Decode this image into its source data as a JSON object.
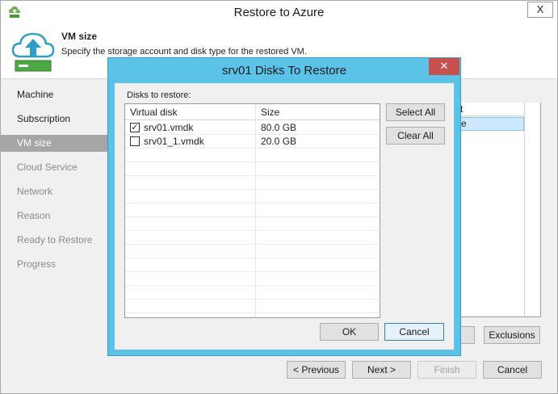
{
  "window": {
    "title": "Restore to Azure",
    "close_glyph": "X"
  },
  "header": {
    "title": "VM size",
    "description": "Specify the storage account and disk type for the restored VM."
  },
  "sidebar": {
    "items": [
      {
        "label": "Machine",
        "state": "normal"
      },
      {
        "label": "Subscription",
        "state": "normal"
      },
      {
        "label": "VM size",
        "state": "active"
      },
      {
        "label": "Cloud Service",
        "state": "disabled"
      },
      {
        "label": "Network",
        "state": "disabled"
      },
      {
        "label": "Reason",
        "state": "disabled"
      },
      {
        "label": "Ready to Restore",
        "state": "disabled"
      },
      {
        "label": "Progress",
        "state": "disabled"
      }
    ]
  },
  "background_grid": {
    "header_fragment": "t",
    "row_fragment": "e"
  },
  "buttons": {
    "exclusions": "Exclusions",
    "previous": "< Previous",
    "next": "Next >",
    "finish": "Finish",
    "cancel": "Cancel"
  },
  "dialog": {
    "title": "srv01 Disks To Restore",
    "close_glyph": "✕",
    "disks_label": "Disks to restore:",
    "columns": {
      "virtual_disk": "Virtual disk",
      "size": "Size"
    },
    "rows": [
      {
        "name": "srv01.vmdk",
        "size": "80.0 GB",
        "checked": true
      },
      {
        "name": "srv01_1.vmdk",
        "size": "20.0 GB",
        "checked": false
      }
    ],
    "buttons": {
      "select_all": "Select All",
      "clear_all": "Clear All",
      "ok": "OK",
      "cancel": "Cancel"
    }
  },
  "colors": {
    "dialog_frame": "#5cc3e8",
    "close_red": "#c75050",
    "active_nav": "#a6a6a6",
    "selection": "#cde8ff"
  },
  "icons": {
    "app": "veeam-app-icon",
    "header": "cloud-upload-icon"
  }
}
